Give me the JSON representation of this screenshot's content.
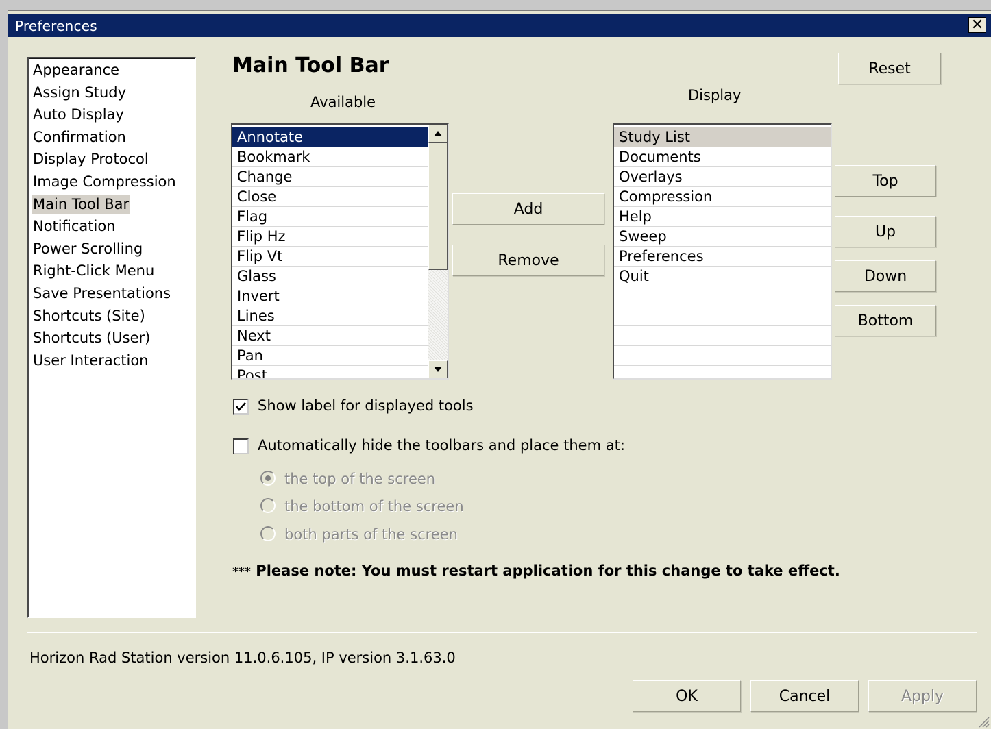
{
  "window": {
    "title": "Preferences",
    "close_icon": "close-icon"
  },
  "categories": [
    {
      "label": "Appearance",
      "selected": false
    },
    {
      "label": "Assign Study",
      "selected": false
    },
    {
      "label": "Auto Display",
      "selected": false
    },
    {
      "label": "Confirmation",
      "selected": false
    },
    {
      "label": "Display Protocol",
      "selected": false
    },
    {
      "label": "Image Compression",
      "selected": false
    },
    {
      "label": "Main Tool Bar",
      "selected": true
    },
    {
      "label": "Notification",
      "selected": false
    },
    {
      "label": "Power Scrolling",
      "selected": false
    },
    {
      "label": "Right-Click Menu",
      "selected": false
    },
    {
      "label": "Save Presentations",
      "selected": false
    },
    {
      "label": "Shortcuts (Site)",
      "selected": false
    },
    {
      "label": "Shortcuts (User)",
      "selected": false
    },
    {
      "label": "User Interaction",
      "selected": false
    }
  ],
  "section": {
    "title": "Main Tool Bar",
    "reset_label": "Reset",
    "available_caption": "Available",
    "display_caption": "Display",
    "available_items": [
      "Annotate",
      "Bookmark",
      "Change",
      "Close",
      "Flag",
      "Flip Hz",
      "Flip Vt",
      "Glass",
      "Invert",
      "Lines",
      "Next",
      "Pan",
      "Post"
    ],
    "available_selected": "Annotate",
    "display_items": [
      "Study List",
      "Documents",
      "Overlays",
      "Compression",
      "Help",
      "Sweep",
      "Preferences",
      "Quit",
      "",
      "",
      "",
      "",
      ""
    ],
    "display_selected": "Study List",
    "add_label": "Add",
    "remove_label": "Remove",
    "top_label": "Top",
    "up_label": "Up",
    "down_label": "Down",
    "bottom_label": "Bottom",
    "show_label_option": {
      "label": "Show label for displayed tools",
      "checked": true
    },
    "auto_hide_option": {
      "label": "Automatically hide the toolbars and place them at:",
      "checked": false
    },
    "placement_options": [
      {
        "label": "the top of the screen",
        "selected": true
      },
      {
        "label": "the bottom  of the screen",
        "selected": false
      },
      {
        "label": "both parts of the screen",
        "selected": false
      }
    ],
    "note_prefix": "***",
    "note_text": " Please note: You must restart application for this change to take effect."
  },
  "footer": {
    "version_text": "Horizon Rad Station version 11.0.6.105,  IP version 3.1.63.0",
    "ok_label": "OK",
    "cancel_label": "Cancel",
    "apply_label": "Apply",
    "apply_enabled": false
  }
}
